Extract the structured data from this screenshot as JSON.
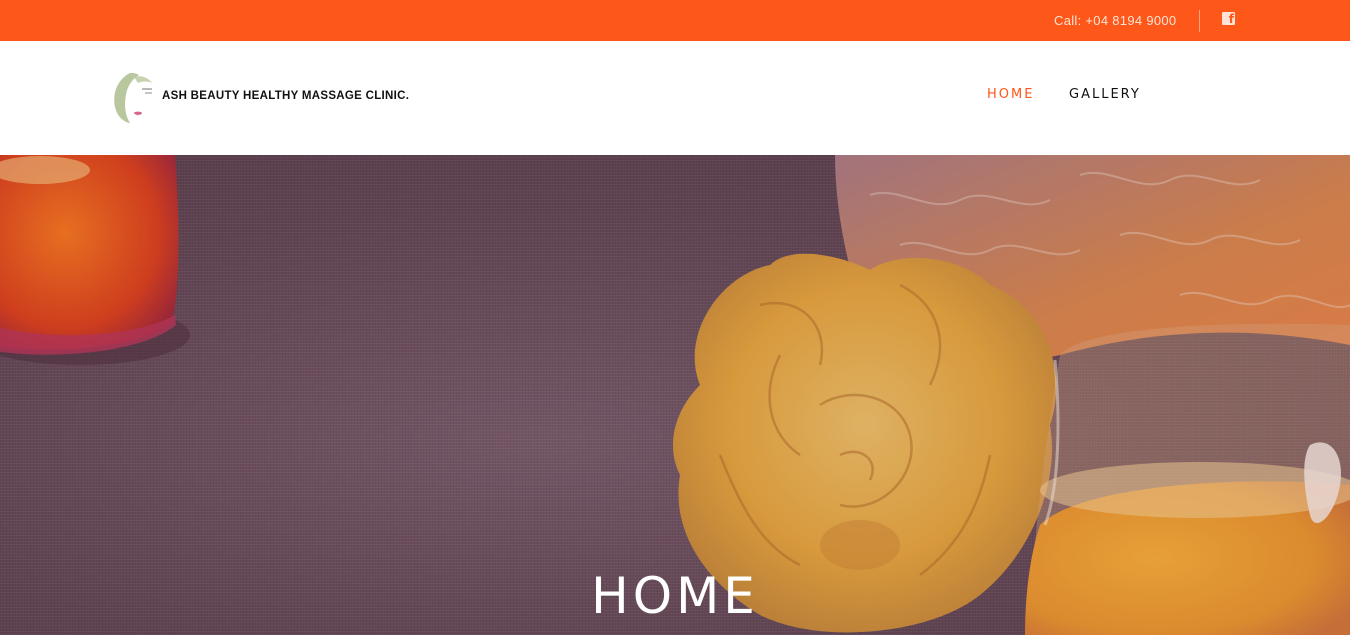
{
  "topbar": {
    "call": "Call: +04 8194 9000",
    "social_icon": "facebook-icon"
  },
  "header": {
    "brand": "ASH BEAUTY HEALTHY MASSAGE CLINIC.",
    "logo_icon": "face-silhouette-logo"
  },
  "nav": {
    "items": [
      {
        "label": "HOME",
        "active": true
      },
      {
        "label": "GALLERY",
        "active": false
      }
    ]
  },
  "hero": {
    "title": "HOME"
  },
  "colors": {
    "accent": "#fd5719",
    "nav_text": "#111111"
  }
}
